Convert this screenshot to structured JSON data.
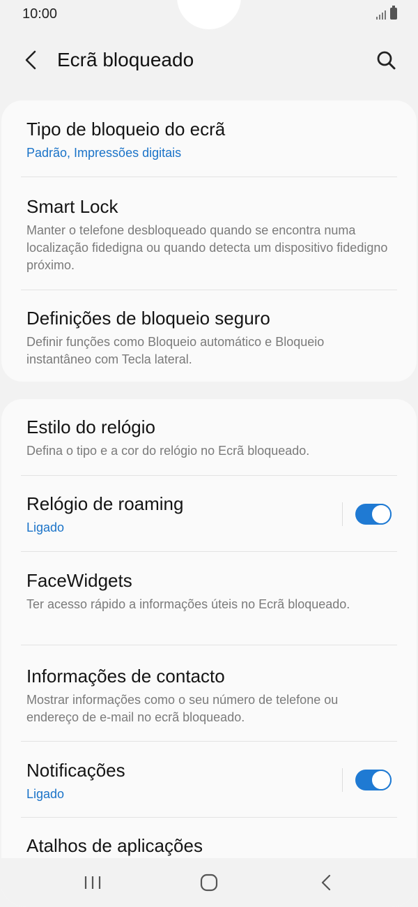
{
  "status_bar": {
    "time": "10:00"
  },
  "header": {
    "title": "Ecrã bloqueado",
    "back_icon": "chevron-left-icon",
    "search_icon": "search-icon"
  },
  "sections": [
    {
      "items": [
        {
          "title": "Tipo de bloqueio do ecrã",
          "subtitle": "Padrão, Impressões digitais",
          "subtitle_color": "#1a73c8"
        },
        {
          "title": "Smart Lock",
          "subtitle": "Manter o telefone desbloqueado quando se encontra numa localização fidedigna ou quando detecta um dispositivo fidedigno próximo."
        },
        {
          "title": "Definições de bloqueio seguro",
          "subtitle": "Definir funções como Bloqueio automático e Bloqueio instantâneo com Tecla lateral."
        }
      ]
    },
    {
      "items": [
        {
          "title": "Estilo do relógio",
          "subtitle": "Defina o tipo e a cor do relógio no Ecrã bloqueado."
        },
        {
          "title": "Relógio de roaming",
          "subtitle": "Ligado",
          "toggle_on": true
        },
        {
          "title": "FaceWidgets",
          "subtitle": "Ter acesso rápido a informações úteis no Ecrã bloqueado."
        },
        {
          "title": "Informações de contacto",
          "subtitle": "Mostrar informações como o seu número de telefone ou endereço de e-mail no ecrã bloqueado."
        },
        {
          "title": "Notificações",
          "subtitle": "Ligado",
          "toggle_on": true
        },
        {
          "title": "Atalhos de aplicações"
        }
      ]
    }
  ],
  "nav_bar": {
    "recents_icon": "recents-icon",
    "home_icon": "home-icon",
    "back_icon": "back-icon"
  },
  "colors": {
    "accent": "#1f7ad3",
    "link": "#1a73c8",
    "background": "#f2f2f2",
    "card": "#fafafa"
  }
}
